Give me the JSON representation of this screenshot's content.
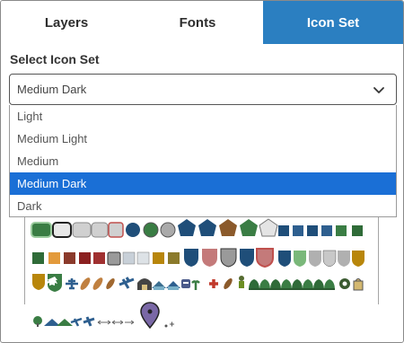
{
  "tabs": [
    {
      "label": "Layers",
      "active": false
    },
    {
      "label": "Fonts",
      "active": false
    },
    {
      "label": "Icon Set",
      "active": true
    }
  ],
  "select_label": "Select Icon Set",
  "select": {
    "value": "Medium Dark",
    "options": [
      "Light",
      "Medium Light",
      "Medium",
      "Medium Dark",
      "Dark"
    ],
    "selected_index": 3
  },
  "colors": {
    "accent": "#2b7fc1",
    "selected_option": "#1a6fd6",
    "icon_blue": "#1f4e79",
    "icon_green": "#3a7d44",
    "icon_brown": "#8b5a2b",
    "icon_gray": "#cfcfcf",
    "icon_red": "#c0504d",
    "icon_gold": "#b8860b",
    "icon_purple": "#7a68a6"
  },
  "icon_preview": {
    "row1": [
      "rounded-rect-green",
      "rounded-rect-dark",
      "rounded-rect-gray",
      "rounded-rect-gray",
      "rounded-rect-red-outline",
      "circle-blue",
      "circle-green",
      "circle-gray",
      "pentagon-blue",
      "pentagon-blue",
      "pentagon-brown",
      "pentagon-green",
      "pentagon-light",
      "square-blue",
      "square-blue",
      "square-blue",
      "square-blue",
      "square-blue",
      "square-green",
      "square-green"
    ],
    "row2": [
      "square-green",
      "square-orange",
      "square-brown",
      "square-red",
      "square-dark-red",
      "square-gray",
      "square-light",
      "square-light",
      "square-gold",
      "square-gold",
      "shield-blue",
      "shield-red",
      "shield-gray",
      "shield-blue",
      "shield-red-outline",
      "shield-blue",
      "shield-green",
      "shield-gray",
      "shield-gray",
      "shield-gold"
    ],
    "row3": [
      "badge-gold",
      "badge-green",
      "airplane-icon",
      "leaf-icon",
      "leaf-icon",
      "leaf-icon",
      "airplane-icon",
      "tunnel-icon",
      "house-icon",
      "house-icon",
      "robot-icon",
      "plant-icon",
      "cross-icon",
      "leaf-icon",
      "soldier-icon",
      "tree-icon",
      "tree-icon",
      "tree-icon",
      "tree-icon",
      "tree-icon",
      "flower-icon",
      "bag-icon"
    ],
    "row4": [
      "tree-icon",
      "tent-icon",
      "airplane-icon",
      "airplane-icon",
      "arrow-icon",
      "arrow-icon",
      "arrow-icon"
    ],
    "marker": "location-pin-icon"
  }
}
